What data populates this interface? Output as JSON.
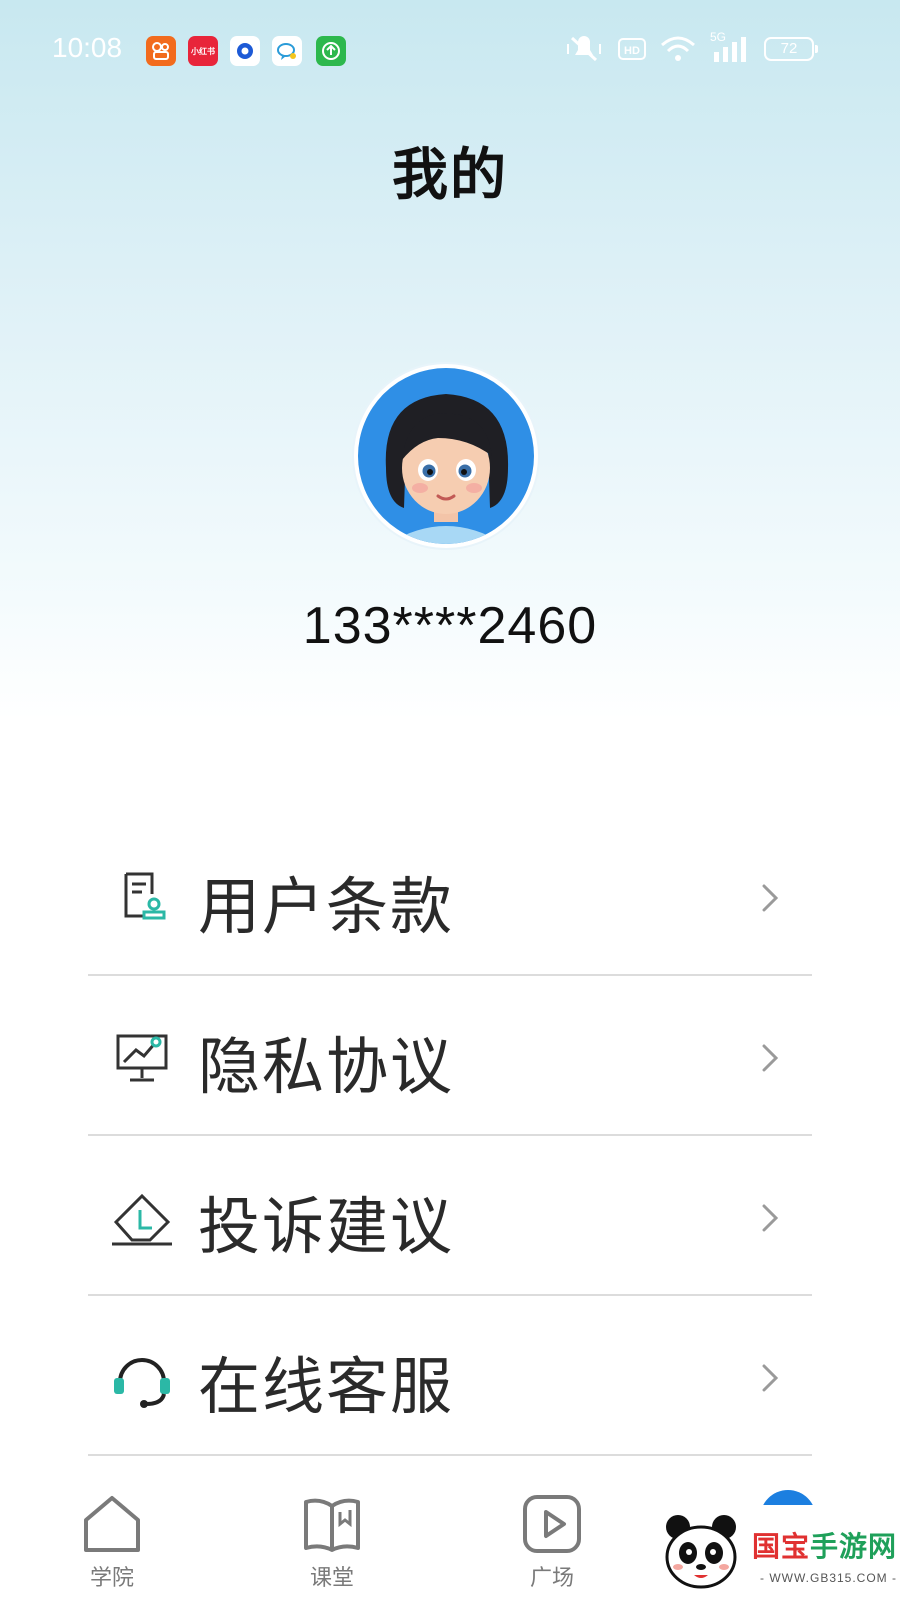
{
  "status_bar": {
    "time": "10:08",
    "notification_icons": [
      {
        "name": "kuaishou-icon",
        "color": "#f26b1d",
        "text": ""
      },
      {
        "name": "xiaohongshu-icon",
        "color": "#e8253a",
        "text": "小红书"
      },
      {
        "name": "browser-icon",
        "color": "#ffffff",
        "text": ""
      },
      {
        "name": "chat-icon",
        "color": "#ffffff",
        "text": ""
      },
      {
        "name": "upload-icon",
        "color": "#2db84d",
        "text": ""
      }
    ],
    "network": "5G",
    "battery": "72"
  },
  "header": {
    "title": "我的"
  },
  "profile": {
    "phone": "133****2460",
    "avatar_icon": "avatar-girl-icon"
  },
  "menu": [
    {
      "label": "用户条款",
      "icon": "user-terms-icon"
    },
    {
      "label": "隐私协议",
      "icon": "privacy-chart-icon"
    },
    {
      "label": "投诉建议",
      "icon": "complaint-envelope-icon"
    },
    {
      "label": "在线客服",
      "icon": "headset-icon"
    }
  ],
  "tabbar": {
    "tabs": [
      {
        "label": "学院",
        "icon": "home-icon"
      },
      {
        "label": "课堂",
        "icon": "book-icon"
      },
      {
        "label": "广场",
        "icon": "play-icon"
      }
    ],
    "active_color": "#1c7fe0"
  },
  "watermark": {
    "brand_prefix": "国宝",
    "brand_suffix": "手游网",
    "url": "- WWW.GB315.COM -"
  },
  "colors": {
    "accent": "#2bb8a6",
    "text": "#2a2a2a",
    "chevron": "#9a9a9a"
  }
}
